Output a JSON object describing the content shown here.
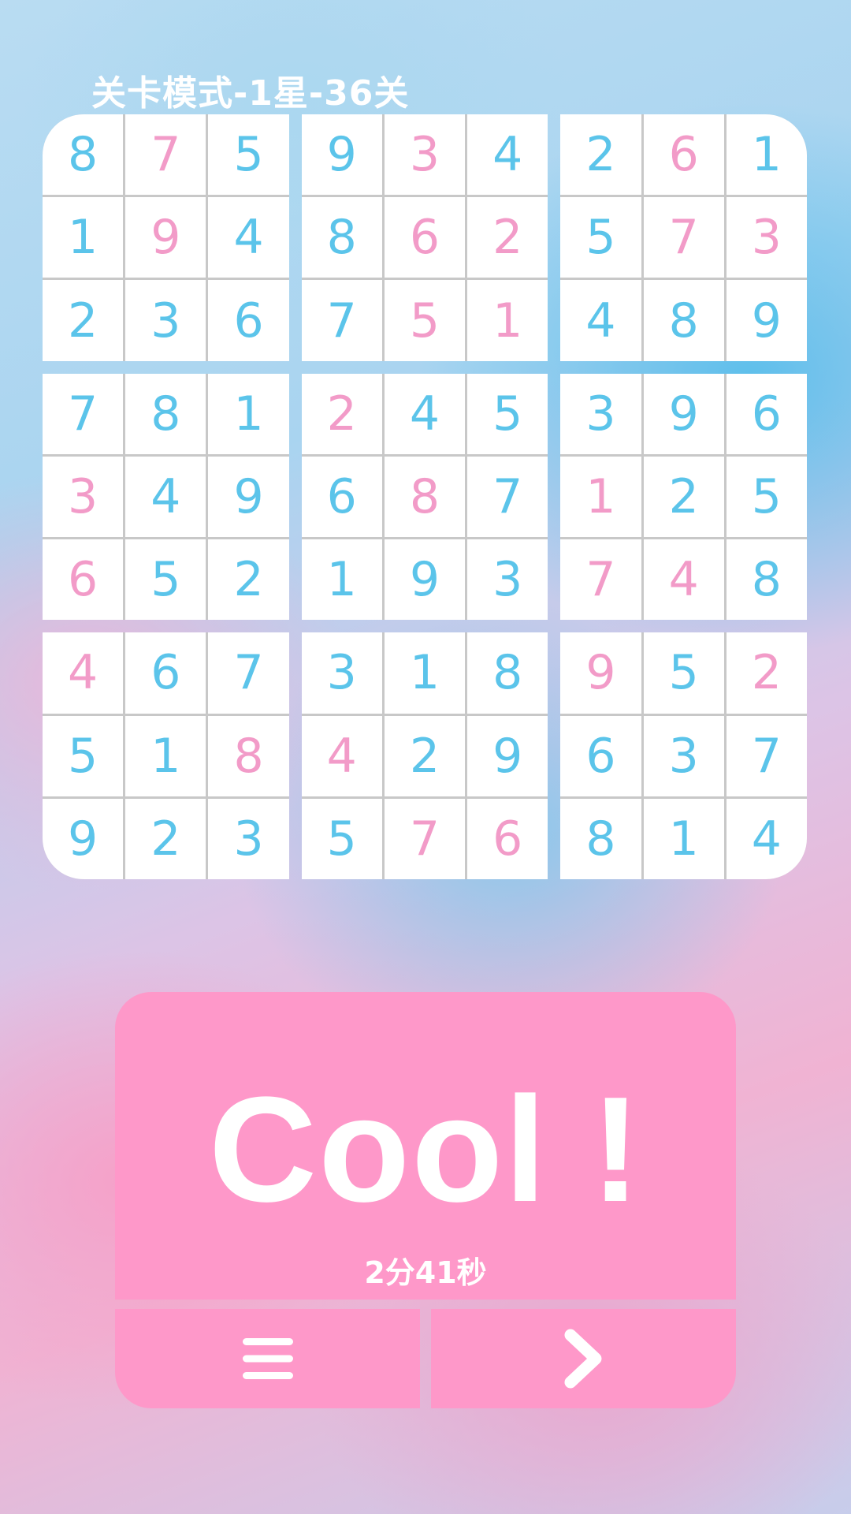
{
  "header": {
    "title": "关卡模式-1星-36关"
  },
  "board": {
    "boxes": [
      [
        {
          "v": "8",
          "k": "given"
        },
        {
          "v": "7",
          "k": "filled"
        },
        {
          "v": "5",
          "k": "given"
        },
        {
          "v": "1",
          "k": "given"
        },
        {
          "v": "9",
          "k": "filled"
        },
        {
          "v": "4",
          "k": "given"
        },
        {
          "v": "2",
          "k": "given"
        },
        {
          "v": "3",
          "k": "given"
        },
        {
          "v": "6",
          "k": "given"
        }
      ],
      [
        {
          "v": "9",
          "k": "given"
        },
        {
          "v": "3",
          "k": "filled"
        },
        {
          "v": "4",
          "k": "given"
        },
        {
          "v": "8",
          "k": "given"
        },
        {
          "v": "6",
          "k": "filled"
        },
        {
          "v": "2",
          "k": "filled"
        },
        {
          "v": "7",
          "k": "given"
        },
        {
          "v": "5",
          "k": "filled"
        },
        {
          "v": "1",
          "k": "filled"
        }
      ],
      [
        {
          "v": "2",
          "k": "given"
        },
        {
          "v": "6",
          "k": "filled"
        },
        {
          "v": "1",
          "k": "given"
        },
        {
          "v": "5",
          "k": "given"
        },
        {
          "v": "7",
          "k": "filled"
        },
        {
          "v": "3",
          "k": "filled"
        },
        {
          "v": "4",
          "k": "given"
        },
        {
          "v": "8",
          "k": "given"
        },
        {
          "v": "9",
          "k": "given"
        }
      ],
      [
        {
          "v": "7",
          "k": "given"
        },
        {
          "v": "8",
          "k": "given"
        },
        {
          "v": "1",
          "k": "given"
        },
        {
          "v": "3",
          "k": "filled"
        },
        {
          "v": "4",
          "k": "given"
        },
        {
          "v": "9",
          "k": "given"
        },
        {
          "v": "6",
          "k": "filled"
        },
        {
          "v": "5",
          "k": "given"
        },
        {
          "v": "2",
          "k": "given"
        }
      ],
      [
        {
          "v": "2",
          "k": "filled"
        },
        {
          "v": "4",
          "k": "given"
        },
        {
          "v": "5",
          "k": "given"
        },
        {
          "v": "6",
          "k": "given"
        },
        {
          "v": "8",
          "k": "filled"
        },
        {
          "v": "7",
          "k": "given"
        },
        {
          "v": "1",
          "k": "given"
        },
        {
          "v": "9",
          "k": "given"
        },
        {
          "v": "3",
          "k": "given"
        }
      ],
      [
        {
          "v": "3",
          "k": "given"
        },
        {
          "v": "9",
          "k": "given"
        },
        {
          "v": "6",
          "k": "given"
        },
        {
          "v": "1",
          "k": "filled"
        },
        {
          "v": "2",
          "k": "given"
        },
        {
          "v": "5",
          "k": "given"
        },
        {
          "v": "7",
          "k": "filled"
        },
        {
          "v": "4",
          "k": "filled"
        },
        {
          "v": "8",
          "k": "given"
        }
      ],
      [
        {
          "v": "4",
          "k": "filled"
        },
        {
          "v": "6",
          "k": "given"
        },
        {
          "v": "7",
          "k": "given"
        },
        {
          "v": "5",
          "k": "given"
        },
        {
          "v": "1",
          "k": "given"
        },
        {
          "v": "8",
          "k": "filled"
        },
        {
          "v": "9",
          "k": "given"
        },
        {
          "v": "2",
          "k": "given"
        },
        {
          "v": "3",
          "k": "given"
        }
      ],
      [
        {
          "v": "3",
          "k": "given"
        },
        {
          "v": "1",
          "k": "given"
        },
        {
          "v": "8",
          "k": "given"
        },
        {
          "v": "4",
          "k": "filled"
        },
        {
          "v": "2",
          "k": "given"
        },
        {
          "v": "9",
          "k": "given"
        },
        {
          "v": "5",
          "k": "given"
        },
        {
          "v": "7",
          "k": "filled"
        },
        {
          "v": "6",
          "k": "filled"
        }
      ],
      [
        {
          "v": "9",
          "k": "filled"
        },
        {
          "v": "5",
          "k": "given"
        },
        {
          "v": "2",
          "k": "filled"
        },
        {
          "v": "6",
          "k": "given"
        },
        {
          "v": "3",
          "k": "given"
        },
        {
          "v": "7",
          "k": "given"
        },
        {
          "v": "8",
          "k": "given"
        },
        {
          "v": "1",
          "k": "given"
        },
        {
          "v": "4",
          "k": "given"
        }
      ]
    ]
  },
  "result": {
    "message": "Cool !",
    "time": "2分41秒"
  },
  "buttons": {
    "menu_icon": "menu-icon",
    "next_icon": "chevron-right-icon"
  },
  "colors": {
    "given_digit": "#5bc4ea",
    "filled_digit": "#f29bc8",
    "panel": "#fe98c9"
  }
}
